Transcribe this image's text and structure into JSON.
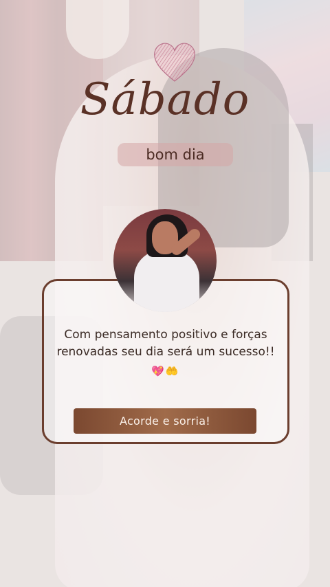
{
  "greeting": {
    "title": "Sábado",
    "subtitle": "bom dia"
  },
  "card": {
    "message": "Com pensamento positivo e forças renovadas seu dia será um sucesso!!",
    "emojis": [
      "💖",
      "🤲"
    ],
    "button_label": "Acorde e sorria!"
  },
  "colors": {
    "title": "#5a3126",
    "card_border": "#6b3e2e",
    "button": "#8a5438",
    "subtitle_pill": "#d6a5a5"
  },
  "icons": {
    "heart": "heart-icon",
    "avatar": "avatar"
  }
}
